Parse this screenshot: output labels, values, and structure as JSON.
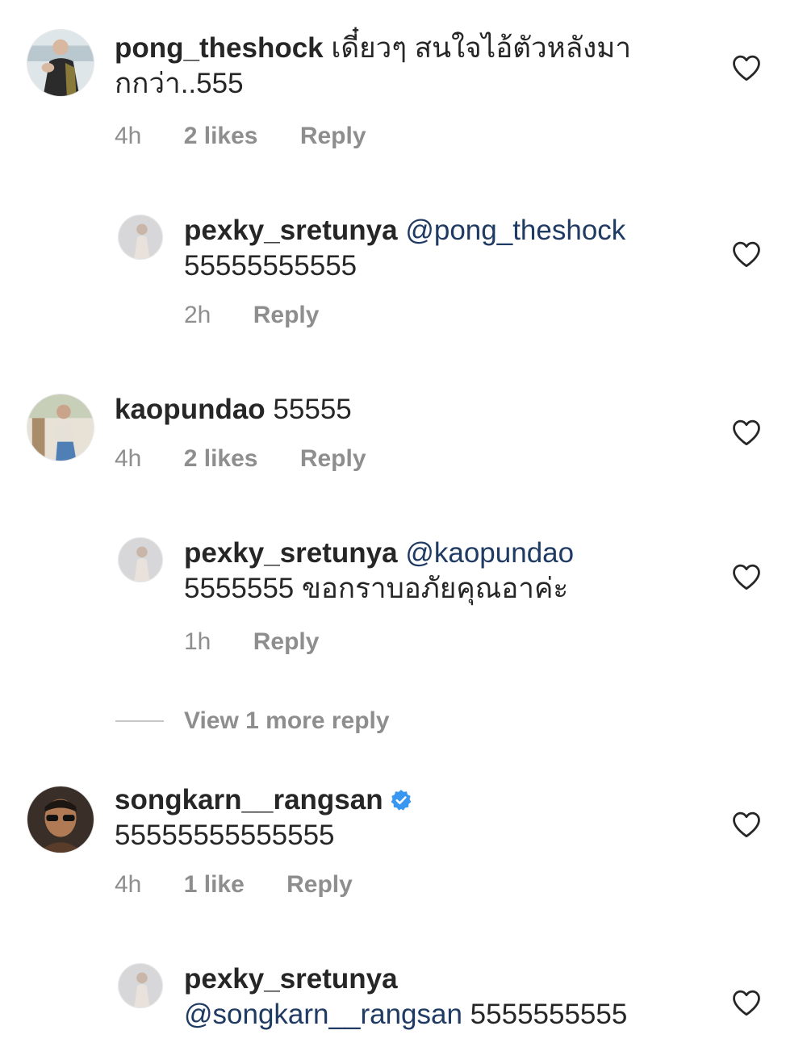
{
  "comments": [
    {
      "username": "pong_theshock",
      "text": "เดี๋ยวๆ สนใจไอ้ตัวหลังมา",
      "text2": "กกว่า..555",
      "time": "4h",
      "likes": "2 likes",
      "reply": "Reply"
    },
    {
      "username": "pexky_sretunya",
      "mention": "@pong_theshock",
      "text": "55555555555",
      "time": "2h",
      "reply": "Reply"
    },
    {
      "username": "kaopundao",
      "text": "55555",
      "time": "4h",
      "likes": "2 likes",
      "reply": "Reply"
    },
    {
      "username": "pexky_sretunya",
      "mention": "@kaopundao",
      "text": "5555555 ขอกราบอภัยคุณอาค่ะ",
      "time": "1h",
      "reply": "Reply"
    },
    {
      "username": "songkarn__rangsan",
      "text": "55555555555555",
      "time": "4h",
      "likes": "1 like",
      "reply": "Reply",
      "verified": true
    },
    {
      "username": "pexky_sretunya",
      "mention": "@songkarn__rangsan",
      "text": "5555555555"
    }
  ],
  "view_more": "View 1 more reply",
  "colors": {
    "mention": "#1f3a63",
    "meta": "#8e8e8e",
    "verified": "#3897f0",
    "heart": "#262626"
  },
  "icons": {
    "like": "heart-outline-icon",
    "verified": "verified-badge-icon"
  }
}
